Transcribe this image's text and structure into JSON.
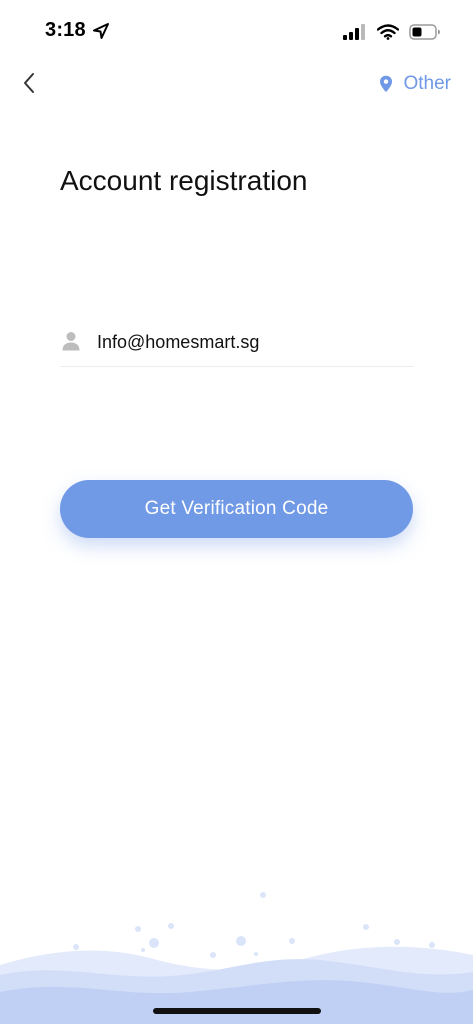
{
  "status_bar": {
    "time": "3:18"
  },
  "nav": {
    "region_label": "Other"
  },
  "page": {
    "title": "Account registration"
  },
  "form": {
    "email_value": "Info@homesmart.sg",
    "verify_button_label": "Get Verification Code"
  },
  "colors": {
    "accent": "#7099e6",
    "wave_light": "#dbe5fa",
    "wave_mid": "#c3d4f5"
  },
  "icons": {
    "back": "chevron-left-icon",
    "region": "location-pin-icon",
    "user": "user-icon",
    "signal": "cellular-signal-icon",
    "wifi": "wifi-icon",
    "battery": "battery-icon"
  }
}
